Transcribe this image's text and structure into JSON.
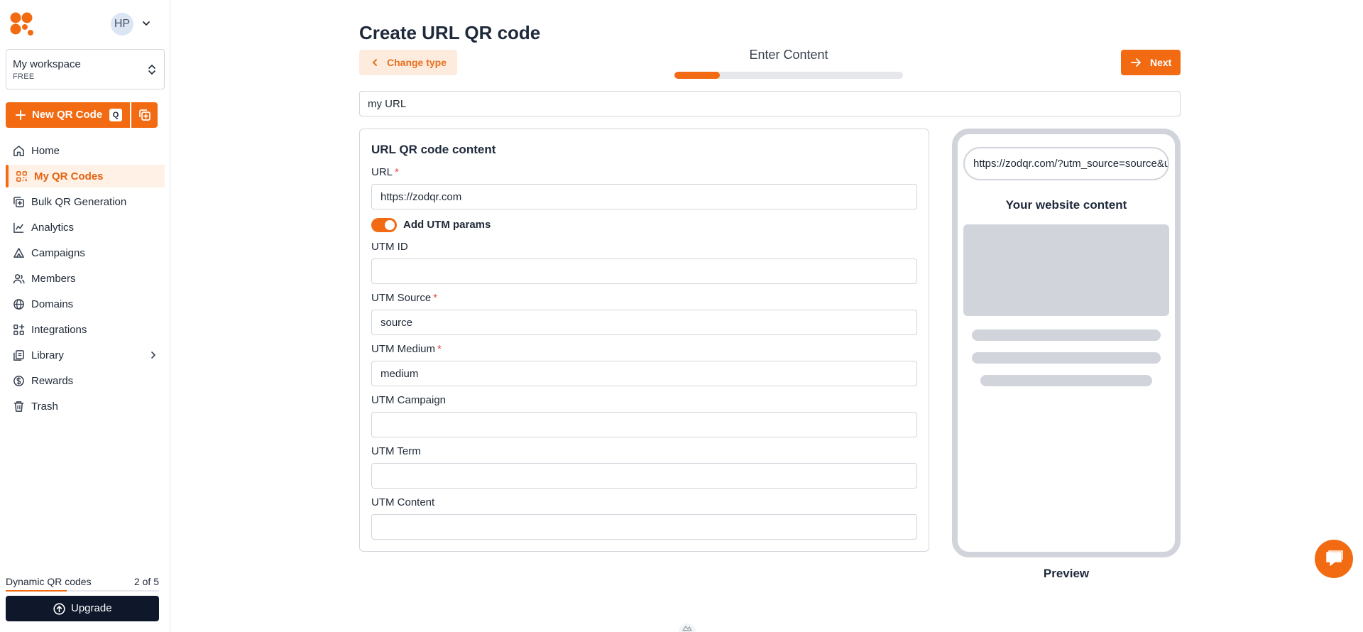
{
  "sidebar": {
    "avatar_initials": "HP",
    "workspace": {
      "name": "My workspace",
      "plan": "FREE"
    },
    "new_qr_label": "New QR Code",
    "new_qr_shortcut": "Q",
    "nav": [
      {
        "label": "Home",
        "icon": "home-icon"
      },
      {
        "label": "My QR Codes",
        "icon": "qr-grid-icon",
        "active": true
      },
      {
        "label": "Bulk QR Generation",
        "icon": "bulk-copy-icon"
      },
      {
        "label": "Analytics",
        "icon": "chart-icon"
      },
      {
        "label": "Campaigns",
        "icon": "campaign-icon"
      },
      {
        "label": "Members",
        "icon": "users-icon"
      },
      {
        "label": "Domains",
        "icon": "globe-icon"
      },
      {
        "label": "Integrations",
        "icon": "integrations-icon"
      },
      {
        "label": "Library",
        "icon": "library-icon",
        "has_submenu": true
      },
      {
        "label": "Rewards",
        "icon": "dollar-icon"
      },
      {
        "label": "Trash",
        "icon": "trash-icon"
      }
    ],
    "quota": {
      "label": "Dynamic QR codes",
      "count_text": "2 of 5",
      "used_fraction": 0.4
    },
    "upgrade_label": "Upgrade"
  },
  "header": {
    "title": "Create URL QR code",
    "change_type_label": "Change type",
    "step_title": "Enter Content",
    "step_progress": 0.2,
    "next_label": "Next"
  },
  "qr_name_value": "my URL",
  "form": {
    "title": "URL QR code content",
    "url": {
      "label": "URL",
      "required": "*",
      "value": "https://zodqr.com"
    },
    "utm_toggle": {
      "label": "Add UTM params",
      "on": true
    },
    "fields": [
      {
        "label": "UTM ID",
        "required": "",
        "value": ""
      },
      {
        "label": "UTM Source",
        "required": "*",
        "value": "source"
      },
      {
        "label": "UTM Medium",
        "required": "*",
        "value": "medium"
      },
      {
        "label": "UTM Campaign",
        "required": "",
        "value": ""
      },
      {
        "label": "UTM Term",
        "required": "",
        "value": ""
      },
      {
        "label": "UTM Content",
        "required": "",
        "value": ""
      }
    ]
  },
  "preview": {
    "url_text": "https://zodqr.com/?utm_source=source&utm_medium=medium",
    "site_title": "Your website content",
    "label": "Preview"
  },
  "colors": {
    "brand": "#f26b13",
    "brand_light": "#fdebdd",
    "dark": "#0f172a",
    "placeholder": "#d1d5db"
  }
}
